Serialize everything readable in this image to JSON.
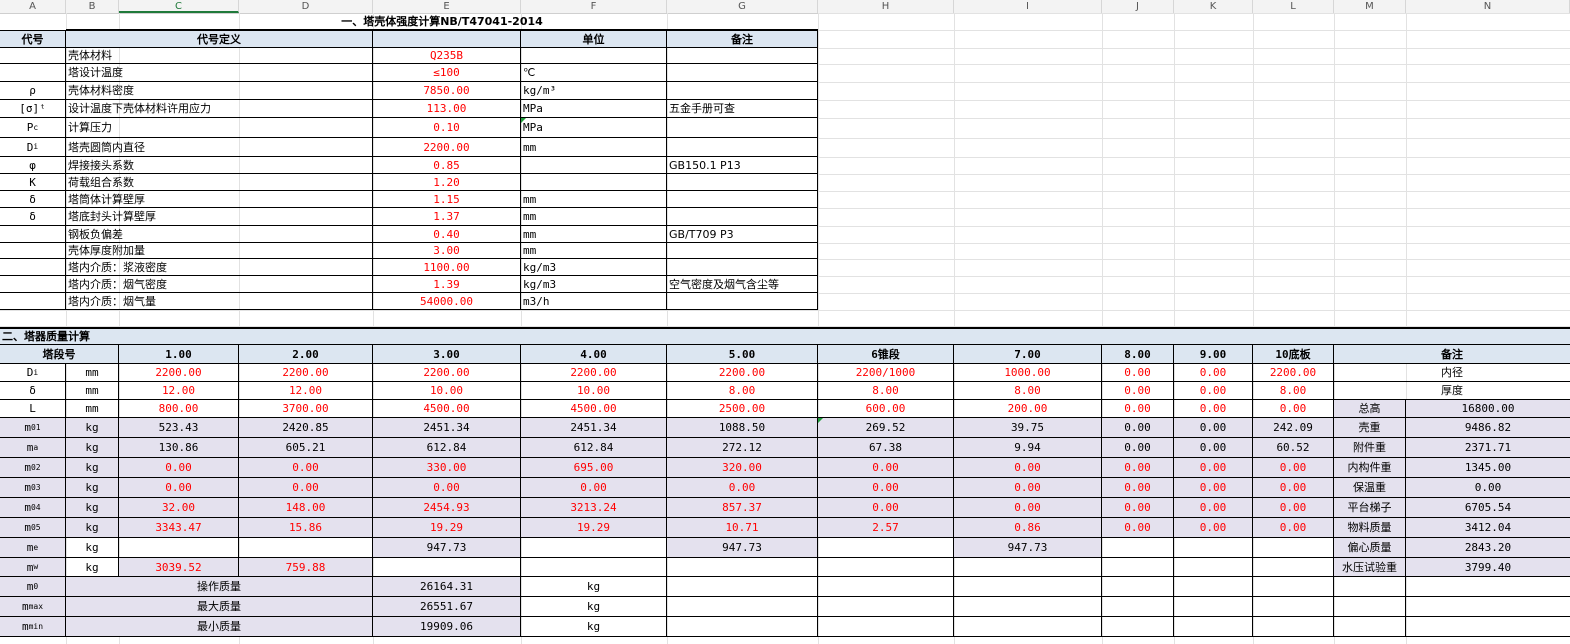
{
  "column_headers": [
    "A",
    "B",
    "C",
    "D",
    "E",
    "F",
    "G",
    "H",
    "I",
    "J",
    "K",
    "L",
    "M",
    "N"
  ],
  "selected_column": "C",
  "section1": {
    "title": "一、塔壳体强度计算NB/T47041-2014",
    "headers": {
      "code": "代号",
      "definition": "代号定义",
      "unit": "单位",
      "note": "备注"
    },
    "rows": [
      {
        "code": "",
        "def": "壳体材料",
        "val": "Q235B",
        "unit": "",
        "note": ""
      },
      {
        "code": "",
        "def": "塔设计温度",
        "val": "≤100",
        "unit": "℃",
        "note": ""
      },
      {
        "code": "ρ",
        "def": "壳体材料密度",
        "val": "7850.00",
        "unit": "kg/m³",
        "note": ""
      },
      {
        "code": "[σ]ᵗ",
        "def": "设计温度下壳体材料许用应力",
        "val": "113.00",
        "unit": "MPa",
        "note": "五金手册可查"
      },
      {
        "code": "Pc",
        "def": "计算压力",
        "val": "0.10",
        "unit": "MPa",
        "note": ""
      },
      {
        "code": "Di",
        "def": "塔壳圆筒内直径",
        "val": "2200.00",
        "unit": "mm",
        "note": ""
      },
      {
        "code": "φ",
        "def": "焊接接头系数",
        "val": "0.85",
        "unit": "",
        "note": "GB150.1  P13"
      },
      {
        "code": "K",
        "def": "荷载组合系数",
        "val": "1.20",
        "unit": "",
        "note": ""
      },
      {
        "code": "δ",
        "def": "塔筒体计算壁厚",
        "val": "1.15",
        "unit": "mm",
        "note": ""
      },
      {
        "code": "δ",
        "def": "塔底封头计算壁厚",
        "val": "1.37",
        "unit": "mm",
        "note": ""
      },
      {
        "code": "",
        "def": "钢板负偏差",
        "val": "0.40",
        "unit": "mm",
        "note": "GB/T709   P3"
      },
      {
        "code": "",
        "def": "壳体厚度附加量",
        "val": "3.00",
        "unit": "mm",
        "note": ""
      },
      {
        "code": "",
        "def": "塔内介质：浆液密度",
        "val": "1100.00",
        "unit": "kg/m3",
        "note": ""
      },
      {
        "code": "",
        "def": "塔内介质：烟气密度",
        "val": "1.39",
        "unit": "kg/m3",
        "note": "空气密度及烟气含尘等"
      },
      {
        "code": "",
        "def": "塔内介质：烟气量",
        "val": "54000.00",
        "unit": "m3/h",
        "note": ""
      }
    ]
  },
  "section2": {
    "title": "二、塔器质量计算",
    "header": {
      "label": "塔段号",
      "segments": [
        "1.00",
        "2.00",
        "3.00",
        "4.00",
        "5.00",
        "6锥段",
        "7.00",
        "8.00",
        "9.00",
        "10底板"
      ],
      "note": "备注"
    },
    "rows": [
      {
        "code": "Di",
        "unit": "mm",
        "vals": [
          "2200.00",
          "2200.00",
          "2200.00",
          "2200.00",
          "2200.00",
          "2200/1000",
          "1000.00",
          "0.00",
          "0.00",
          "2200.00"
        ],
        "red": true,
        "note_label": "内径",
        "note_value": ""
      },
      {
        "code": "δ",
        "unit": "mm",
        "vals": [
          "12.00",
          "12.00",
          "10.00",
          "10.00",
          "8.00",
          "8.00",
          "8.00",
          "0.00",
          "0.00",
          "8.00"
        ],
        "red": true,
        "note_label": "厚度",
        "note_value": ""
      },
      {
        "code": "L",
        "unit": "mm",
        "vals": [
          "800.00",
          "3700.00",
          "4500.00",
          "4500.00",
          "2500.00",
          "600.00",
          "200.00",
          "0.00",
          "0.00",
          "0.00"
        ],
        "red": true,
        "note_label": "总高",
        "note_value": "16800.00"
      },
      {
        "code": "m01",
        "unit": "kg",
        "vals": [
          "523.43",
          "2420.85",
          "2451.34",
          "2451.34",
          "1088.50",
          "269.52",
          "39.75",
          "0.00",
          "0.00",
          "242.09"
        ],
        "red": false,
        "note_label": "壳重",
        "note_value": "9486.82"
      },
      {
        "code": "ma",
        "unit": "kg",
        "vals": [
          "130.86",
          "605.21",
          "612.84",
          "612.84",
          "272.12",
          "67.38",
          "9.94",
          "0.00",
          "0.00",
          "60.52"
        ],
        "red": false,
        "note_label": "附件重",
        "note_value": "2371.71"
      },
      {
        "code": "m02",
        "unit": "kg",
        "vals": [
          "0.00",
          "0.00",
          "330.00",
          "695.00",
          "320.00",
          "0.00",
          "0.00",
          "0.00",
          "0.00",
          "0.00"
        ],
        "red": true,
        "note_label": "内构件重",
        "note_value": "1345.00"
      },
      {
        "code": "m03",
        "unit": "kg",
        "vals": [
          "0.00",
          "0.00",
          "0.00",
          "0.00",
          "0.00",
          "0.00",
          "0.00",
          "0.00",
          "0.00",
          "0.00"
        ],
        "red": true,
        "note_label": "保温重",
        "note_value": "0.00"
      },
      {
        "code": "m04",
        "unit": "kg",
        "vals": [
          "32.00",
          "148.00",
          "2454.93",
          "3213.24",
          "857.37",
          "0.00",
          "0.00",
          "0.00",
          "0.00",
          "0.00"
        ],
        "red": true,
        "note_label": "平台梯子",
        "note_value": "6705.54"
      },
      {
        "code": "m05",
        "unit": "kg",
        "vals": [
          "3343.47",
          "15.86",
          "19.29",
          "19.29",
          "10.71",
          "2.57",
          "0.86",
          "0.00",
          "0.00",
          "0.00"
        ],
        "red": true,
        "note_label": "物料质量",
        "note_value": "3412.04"
      },
      {
        "code": "me",
        "unit": "kg",
        "vals": [
          "",
          "",
          "947.73",
          "",
          "947.73",
          "",
          "947.73",
          "",
          "",
          ""
        ],
        "red": false,
        "note_label": "偏心质量",
        "note_value": "2843.20"
      },
      {
        "code": "mw",
        "unit": "kg",
        "vals": [
          "3039.52",
          "759.88",
          "",
          "",
          "",
          "",
          "",
          "",
          "",
          ""
        ],
        "red": true,
        "note_label": "水压试验重",
        "note_value": "3799.40"
      }
    ],
    "totals": [
      {
        "code": "m0",
        "label": "操作质量",
        "val": "26164.31",
        "unit": "kg"
      },
      {
        "code": "mmax",
        "label": "最大质量",
        "val": "26551.67",
        "unit": "kg"
      },
      {
        "code": "mmin",
        "label": "最小质量",
        "val": "19909.06",
        "unit": "kg"
      }
    ]
  }
}
